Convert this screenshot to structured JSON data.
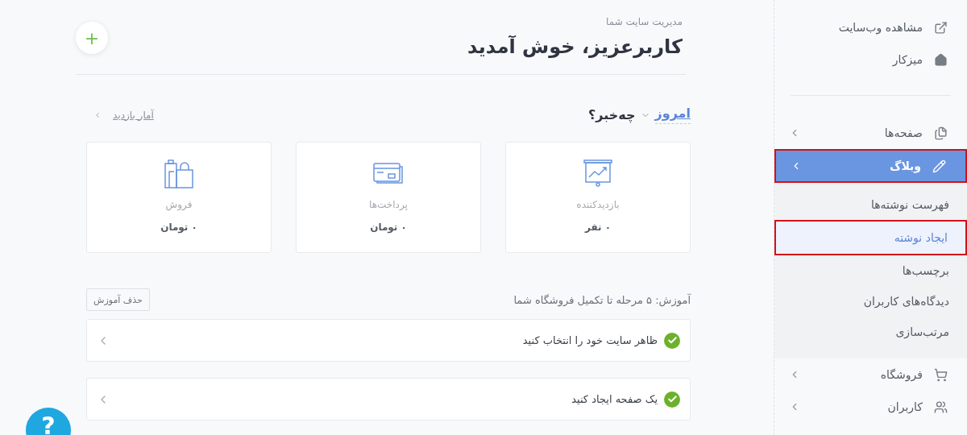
{
  "sidebar": {
    "top_items": [
      {
        "label": "مشاهده وب‌سایت"
      },
      {
        "label": "میزکار"
      }
    ],
    "menu": [
      {
        "label": "صفحه‌ها",
        "selected": false,
        "annotated": false
      },
      {
        "label": "وبلاگ",
        "selected": true,
        "annotated": true,
        "children": [
          {
            "label": "فهرست نوشته‌ها",
            "selected": false,
            "annotated": false
          },
          {
            "label": "ایجاد نوشته",
            "selected": true,
            "annotated": true
          },
          {
            "label": "برچسب‌ها",
            "selected": false,
            "annotated": false
          },
          {
            "label": "دیدگاه‌های کاربران",
            "selected": false,
            "annotated": false
          },
          {
            "label": "مرتب‌سازی",
            "selected": false,
            "annotated": false
          }
        ]
      },
      {
        "label": "فروشگاه",
        "selected": false,
        "annotated": false
      },
      {
        "label": "کاربران",
        "selected": false,
        "annotated": false
      }
    ]
  },
  "header": {
    "subtitle": "مدیریت سایت شما",
    "title": "کاربرعزیز، خوش آمدید",
    "add_button": "+"
  },
  "news": {
    "period": "امروز",
    "heading": "چه‌خبر؟",
    "stats_link": "آمار بازدید"
  },
  "cards": [
    {
      "label": "بازدیدکننده",
      "value": "۰ نفر"
    },
    {
      "label": "پرداخت‌ها",
      "value": "۰ تومان"
    },
    {
      "label": "فروش",
      "value": "۰ تومان"
    }
  ],
  "tutorial": {
    "title": "آموزش: ۵ مرحله تا تکمیل فروشگاه شما",
    "remove_button": "حذف آموزش",
    "steps": [
      {
        "label": "ظاهر سایت خود را انتخاب کنید",
        "done": true
      },
      {
        "label": "یک صفحه ایجاد کنید",
        "done": true
      }
    ]
  },
  "help_button": "?"
}
